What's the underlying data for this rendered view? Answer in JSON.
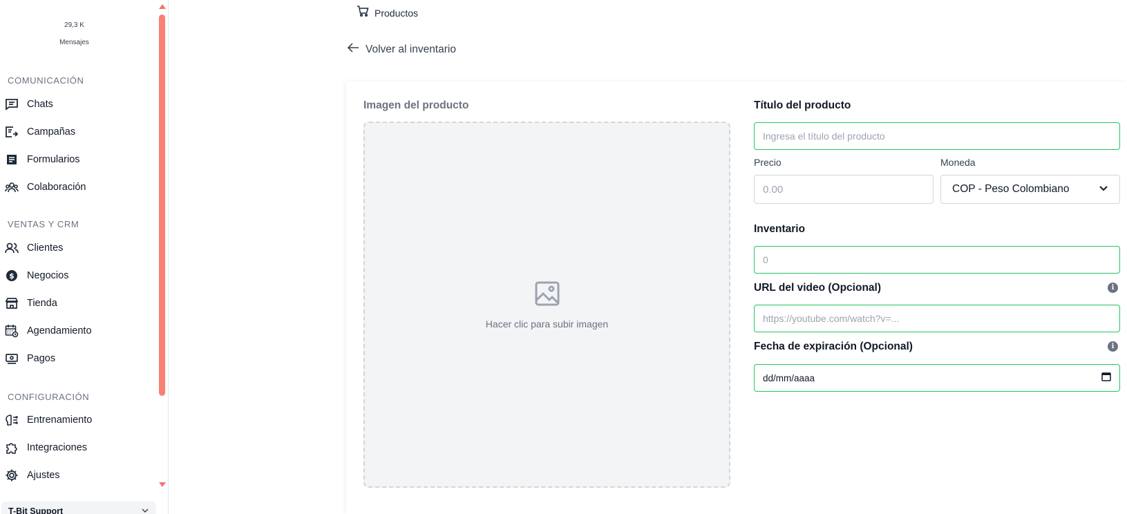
{
  "sidebar": {
    "stat": {
      "value": "29,3 K",
      "label": "Mensajes"
    },
    "sections": [
      {
        "title": "Comunicación"
      },
      {
        "title": "Ventas y CRM"
      },
      {
        "title": "Configuración"
      }
    ],
    "items": [
      {
        "label": "Chats",
        "icon": "chat-icon"
      },
      {
        "label": "Campañas",
        "icon": "campaign-icon"
      },
      {
        "label": "Formularios",
        "icon": "form-icon"
      },
      {
        "label": "Colaboración",
        "icon": "team-icon"
      },
      {
        "label": "Clientes",
        "icon": "users-icon"
      },
      {
        "label": "Negocios",
        "icon": "dollar-icon"
      },
      {
        "label": "Tienda",
        "icon": "store-icon"
      },
      {
        "label": "Agendamiento",
        "icon": "calendar-icon"
      },
      {
        "label": "Pagos",
        "icon": "payment-icon"
      },
      {
        "label": "Entrenamiento",
        "icon": "brain-icon"
      },
      {
        "label": "Integraciones",
        "icon": "puzzle-icon"
      },
      {
        "label": "Ajustes",
        "icon": "gear-icon"
      }
    ],
    "account": {
      "name": "T-Bit Support"
    },
    "scrollbar_color": "#fa8072"
  },
  "header": {
    "breadcrumb": "Productos",
    "back_label": "Volver al inventario"
  },
  "form": {
    "image_label": "Imagen del producto",
    "image_hint": "Hacer clic para subir imagen",
    "title_label": "Título del producto",
    "title_placeholder": "Ingresa el título del producto",
    "price_label": "Precio",
    "price_placeholder": "0.00",
    "currency_label": "Moneda",
    "currency_value": "COP - Peso Colombiano",
    "inventory_label": "Inventario",
    "inventory_placeholder": "0",
    "video_label": "URL del video (Opcional)",
    "video_placeholder": "https://youtube.com/watch?v=...",
    "expiry_label": "Fecha de expiración (Opcional)",
    "expiry_value": "dd/mm/aaaa",
    "info_glyph": "i",
    "valid_border_color": "#22c55e"
  }
}
